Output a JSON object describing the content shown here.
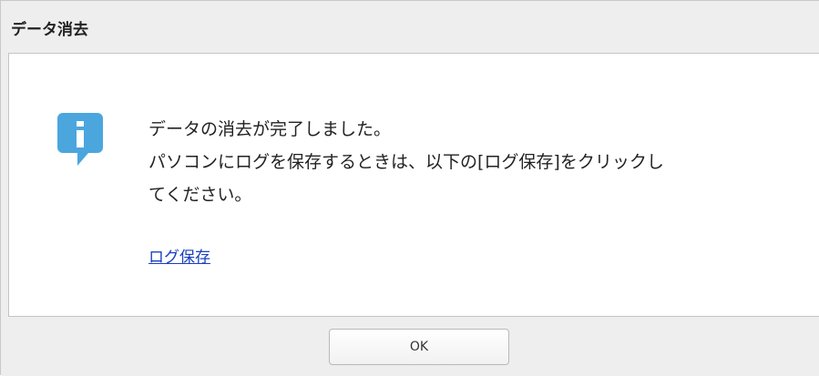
{
  "dialog": {
    "title": "データ消去",
    "icon": "info-icon",
    "message_lines": [
      "データの消去が完了しました。",
      "パソコンにログを保存するときは、以下の[ログ保存]をクリックし",
      "てください。"
    ],
    "link_label": "ログ保存",
    "ok_label": "OK"
  },
  "colors": {
    "accent_icon": "#4ba6dd",
    "link": "#1a3fbf",
    "background": "#eeeeee"
  }
}
